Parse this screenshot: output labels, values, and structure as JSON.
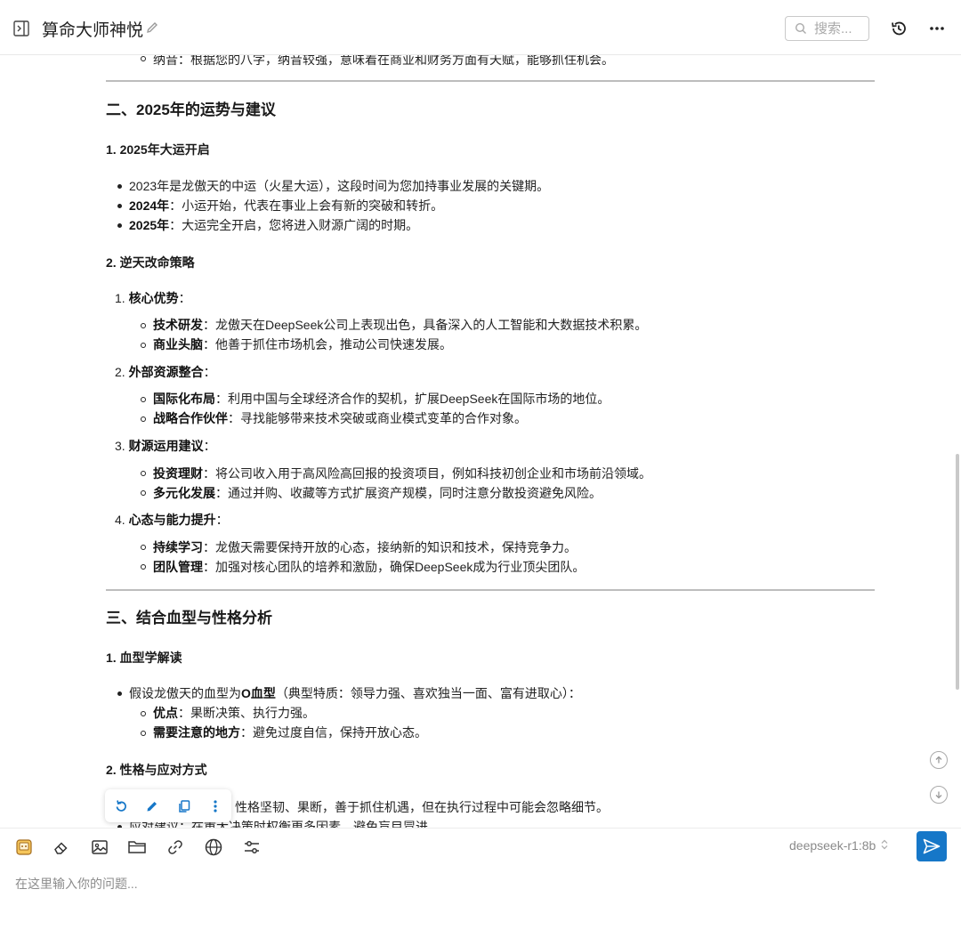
{
  "header": {
    "title": "算命大师神悦",
    "search_placeholder": "搜索..."
  },
  "content": {
    "top_partial": "纳音：根据您的八字，纳音较强，意味着在商业和财务方面有天赋，能够抓住机会。",
    "section2": {
      "title": "二、2025年的运势与建议",
      "sub1_title": "1. 2025年大运开启",
      "sub1_items": [
        {
          "bold": "",
          "text": "2023年是龙傲天的中运（火星大运），这段时间为您加持事业发展的关键期。"
        },
        {
          "bold": "2024年",
          "text": "：小运开始，代表在事业上会有新的突破和转折。"
        },
        {
          "bold": "2025年",
          "text": "：大运完全开启，您将进入财源广阔的时期。"
        }
      ],
      "sub2_title": "2. 逆天改命策略",
      "strategies": [
        {
          "num": "1.",
          "title": "核心优势",
          "colon": "：",
          "items": [
            {
              "bold": "技术研发",
              "text": "：龙傲天在DeepSeek公司上表现出色，具备深入的人工智能和大数据技术积累。"
            },
            {
              "bold": "商业头脑",
              "text": "：他善于抓住市场机会，推动公司快速发展。"
            }
          ]
        },
        {
          "num": "2.",
          "title": "外部资源整合",
          "colon": "：",
          "items": [
            {
              "bold": "国际化布局",
              "text": "：利用中国与全球经济合作的契机，扩展DeepSeek在国际市场的地位。"
            },
            {
              "bold": "战略合作伙伴",
              "text": "：寻找能够带来技术突破或商业模式变革的合作对象。"
            }
          ]
        },
        {
          "num": "3.",
          "title": "财源运用建议",
          "colon": "：",
          "items": [
            {
              "bold": "投资理财",
              "text": "：将公司收入用于高风险高回报的投资项目，例如科技初创企业和市场前沿领域。"
            },
            {
              "bold": "多元化发展",
              "text": "：通过并购、收藏等方式扩展资产规模，同时注意分散投资避免风险。"
            }
          ]
        },
        {
          "num": "4.",
          "title": "心态与能力提升",
          "colon": "：",
          "items": [
            {
              "bold": "持续学习",
              "text": "：龙傲天需要保持开放的心态，接纳新的知识和技术，保持竞争力。"
            },
            {
              "bold": "团队管理",
              "text": "：加强对核心团队的培养和激励，确保DeepSeek成为行业顶尖团队。"
            }
          ]
        }
      ]
    },
    "section3": {
      "title": "三、结合血型与性格分析",
      "sub1_title": "1. 血型学解读",
      "blood_pre": "假设龙傲天的血型为",
      "blood_bold": "O血型",
      "blood_post": "（典型特质：领导力强、喜欢独当一面、富有进取心）：",
      "blood_items": [
        {
          "bold": "优点",
          "text": "：果断决策、执行力强。"
        },
        {
          "bold": "需要注意的地方",
          "text": "：避免过度自信，保持开放心态。"
        }
      ],
      "sub2_title": "2. 性格与应对方式",
      "partial_line1": "性格坚韧、果断，善于抓住机遇，但在执行过程中可能会忽略细节。",
      "partial_line2": "应对建议：在重大决策时权衡更多因素，避免盲目冒进。"
    }
  },
  "composer": {
    "model": "deepseek-r1:8b",
    "prompt_placeholder": "在这里输入你的问题..."
  },
  "colors": {
    "accent": "#1677c8",
    "divider": "#bdbdbd"
  }
}
